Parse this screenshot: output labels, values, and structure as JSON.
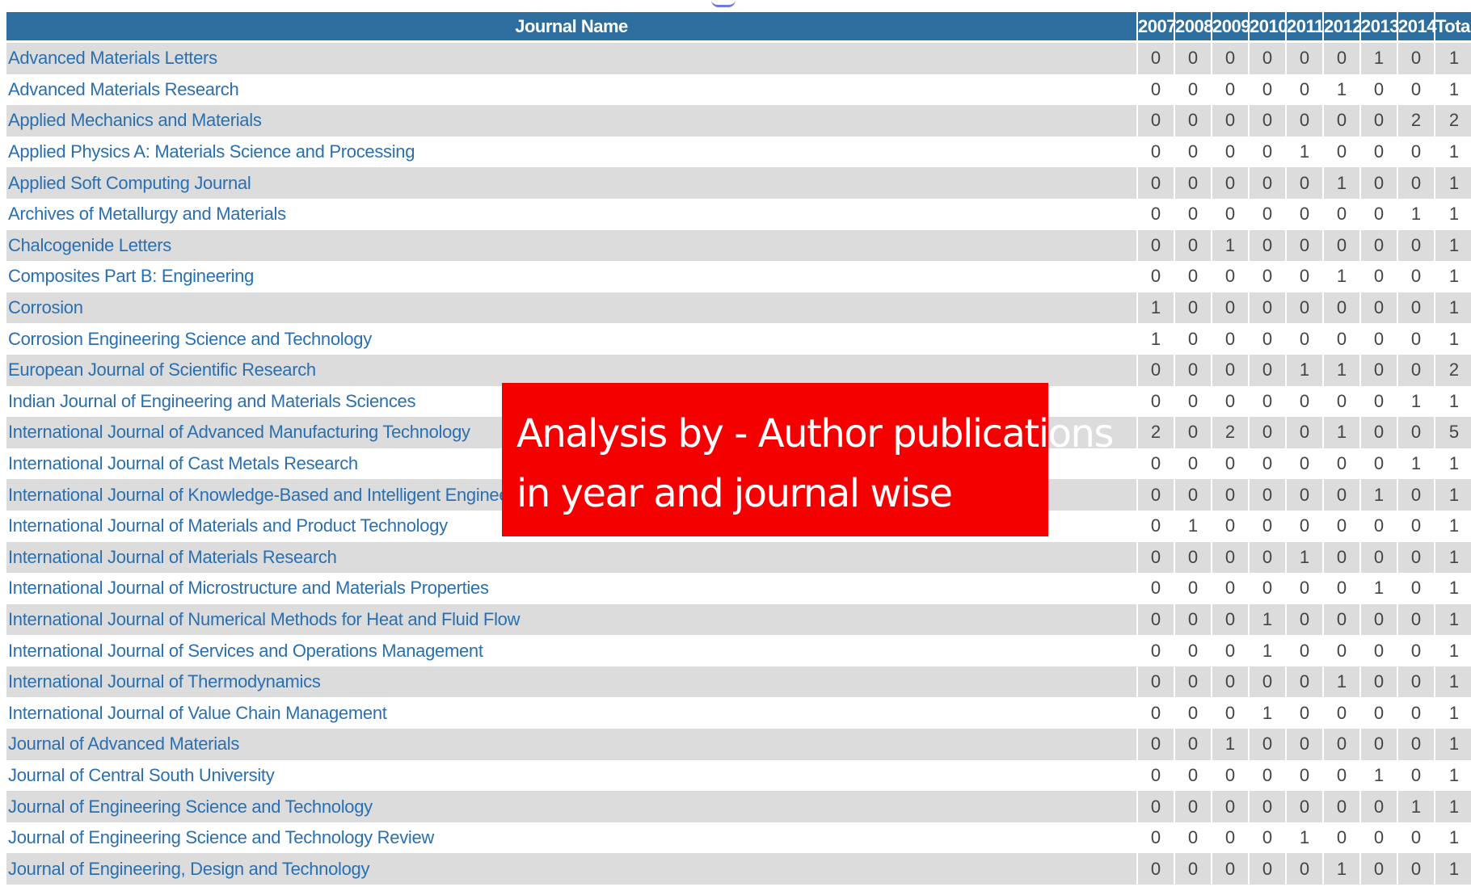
{
  "table": {
    "columns": [
      "Journal Name",
      "2007",
      "2008",
      "2009",
      "2010",
      "2011",
      "2012",
      "2013",
      "2014",
      "Total"
    ],
    "rows": [
      {
        "name": "Advanced Materials Letters",
        "values": [
          "0",
          "0",
          "0",
          "0",
          "0",
          "0",
          "1",
          "0",
          "1"
        ]
      },
      {
        "name": "Advanced Materials Research",
        "values": [
          "0",
          "0",
          "0",
          "0",
          "0",
          "1",
          "0",
          "0",
          "1"
        ]
      },
      {
        "name": "Applied Mechanics and Materials",
        "values": [
          "0",
          "0",
          "0",
          "0",
          "0",
          "0",
          "0",
          "2",
          "2"
        ]
      },
      {
        "name": "Applied Physics A: Materials Science and Processing",
        "values": [
          "0",
          "0",
          "0",
          "0",
          "1",
          "0",
          "0",
          "0",
          "1"
        ]
      },
      {
        "name": "Applied Soft Computing Journal",
        "values": [
          "0",
          "0",
          "0",
          "0",
          "0",
          "1",
          "0",
          "0",
          "1"
        ]
      },
      {
        "name": "Archives of Metallurgy and Materials",
        "values": [
          "0",
          "0",
          "0",
          "0",
          "0",
          "0",
          "0",
          "1",
          "1"
        ]
      },
      {
        "name": "Chalcogenide Letters",
        "values": [
          "0",
          "0",
          "1",
          "0",
          "0",
          "0",
          "0",
          "0",
          "1"
        ]
      },
      {
        "name": "Composites Part B: Engineering",
        "values": [
          "0",
          "0",
          "0",
          "0",
          "0",
          "1",
          "0",
          "0",
          "1"
        ]
      },
      {
        "name": "Corrosion",
        "values": [
          "1",
          "0",
          "0",
          "0",
          "0",
          "0",
          "0",
          "0",
          "1"
        ]
      },
      {
        "name": "Corrosion Engineering Science and Technology",
        "values": [
          "1",
          "0",
          "0",
          "0",
          "0",
          "0",
          "0",
          "0",
          "1"
        ]
      },
      {
        "name": "European Journal of Scientific Research",
        "values": [
          "0",
          "0",
          "0",
          "0",
          "1",
          "1",
          "0",
          "0",
          "2"
        ]
      },
      {
        "name": "Indian Journal of Engineering and Materials Sciences",
        "values": [
          "0",
          "0",
          "0",
          "0",
          "0",
          "0",
          "0",
          "1",
          "1"
        ]
      },
      {
        "name": "International Journal of Advanced Manufacturing Technology",
        "values": [
          "2",
          "0",
          "2",
          "0",
          "0",
          "1",
          "0",
          "0",
          "5"
        ]
      },
      {
        "name": "International Journal of Cast Metals Research",
        "values": [
          "0",
          "0",
          "0",
          "0",
          "0",
          "0",
          "0",
          "1",
          "1"
        ]
      },
      {
        "name": "International Journal of Knowledge-Based and Intelligent Engineering Systems",
        "values": [
          "0",
          "0",
          "0",
          "0",
          "0",
          "0",
          "1",
          "0",
          "1"
        ]
      },
      {
        "name": "International Journal of Materials and Product Technology",
        "values": [
          "0",
          "1",
          "0",
          "0",
          "0",
          "0",
          "0",
          "0",
          "1"
        ]
      },
      {
        "name": "International Journal of Materials Research",
        "values": [
          "0",
          "0",
          "0",
          "0",
          "1",
          "0",
          "0",
          "0",
          "1"
        ]
      },
      {
        "name": "International Journal of Microstructure and Materials Properties",
        "values": [
          "0",
          "0",
          "0",
          "0",
          "0",
          "0",
          "1",
          "0",
          "1"
        ]
      },
      {
        "name": "International Journal of Numerical Methods for Heat and Fluid Flow",
        "values": [
          "0",
          "0",
          "0",
          "1",
          "0",
          "0",
          "0",
          "0",
          "1"
        ]
      },
      {
        "name": "International Journal of Services and Operations Management",
        "values": [
          "0",
          "0",
          "0",
          "1",
          "0",
          "0",
          "0",
          "0",
          "1"
        ]
      },
      {
        "name": "International Journal of Thermodynamics",
        "values": [
          "0",
          "0",
          "0",
          "0",
          "0",
          "1",
          "0",
          "0",
          "1"
        ]
      },
      {
        "name": "International Journal of Value Chain Management",
        "values": [
          "0",
          "0",
          "0",
          "1",
          "0",
          "0",
          "0",
          "0",
          "1"
        ]
      },
      {
        "name": "Journal of Advanced Materials",
        "values": [
          "0",
          "0",
          "1",
          "0",
          "0",
          "0",
          "0",
          "0",
          "1"
        ]
      },
      {
        "name": "Journal of Central South University",
        "values": [
          "0",
          "0",
          "0",
          "0",
          "0",
          "0",
          "1",
          "0",
          "1"
        ]
      },
      {
        "name": "Journal of Engineering Science and Technology",
        "values": [
          "0",
          "0",
          "0",
          "0",
          "0",
          "0",
          "0",
          "1",
          "1"
        ]
      },
      {
        "name": "Journal of Engineering Science and Technology Review",
        "values": [
          "0",
          "0",
          "0",
          "0",
          "1",
          "0",
          "0",
          "0",
          "1"
        ]
      },
      {
        "name": "Journal of Engineering, Design and Technology",
        "values": [
          "0",
          "0",
          "0",
          "0",
          "0",
          "1",
          "0",
          "0",
          "1"
        ]
      }
    ]
  },
  "overlay": {
    "line1": "Analysis by - Author publications",
    "line2": "in year and journal wise"
  },
  "colors": {
    "header_bg": "#2e6e9e",
    "link": "#2a6fb0",
    "stripe": "#dcdcdc",
    "overlay_bg": "#f40000"
  }
}
